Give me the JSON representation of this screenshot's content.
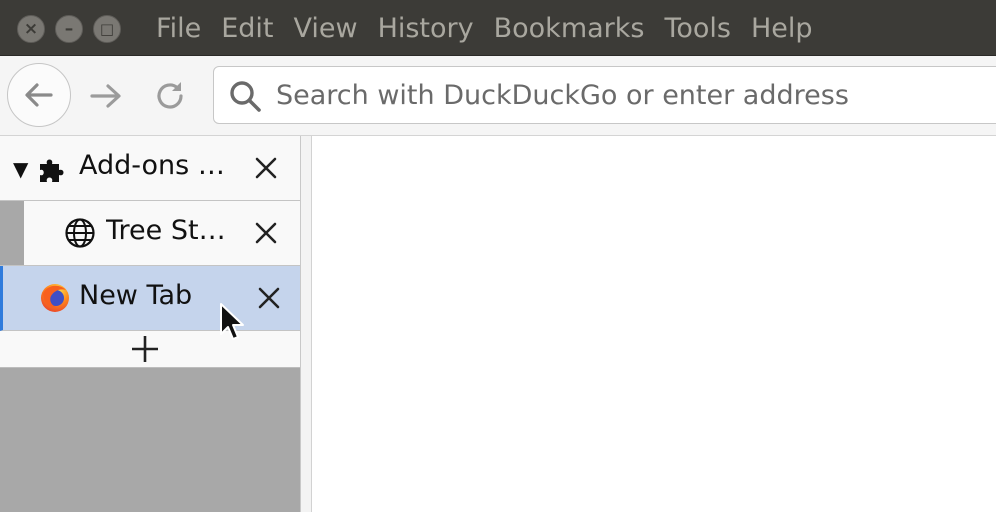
{
  "window": {
    "controls": {
      "close": "×",
      "minimize": "–",
      "maximize": "□"
    }
  },
  "menu": {
    "items": [
      "File",
      "Edit",
      "View",
      "History",
      "Bookmarks",
      "Tools",
      "Help"
    ]
  },
  "toolbar": {
    "url_placeholder": "Search with DuckDuckGo or enter address"
  },
  "sidebar": {
    "tabs": [
      {
        "label": "Add-ons M…",
        "icon": "puzzle-icon",
        "expanded": true
      },
      {
        "label": "Tree Styl…",
        "icon": "globe-icon"
      },
      {
        "label": "New Tab",
        "icon": "firefox-icon",
        "active": true
      }
    ],
    "new_tab_label": "+"
  },
  "colors": {
    "titlebar": "#3c3b37",
    "menu_text": "#a9a79f",
    "active_tab": "#c5d4ec",
    "active_tab_accent": "#2f7bdc",
    "sidebar_bg": "#a8a8a8"
  }
}
